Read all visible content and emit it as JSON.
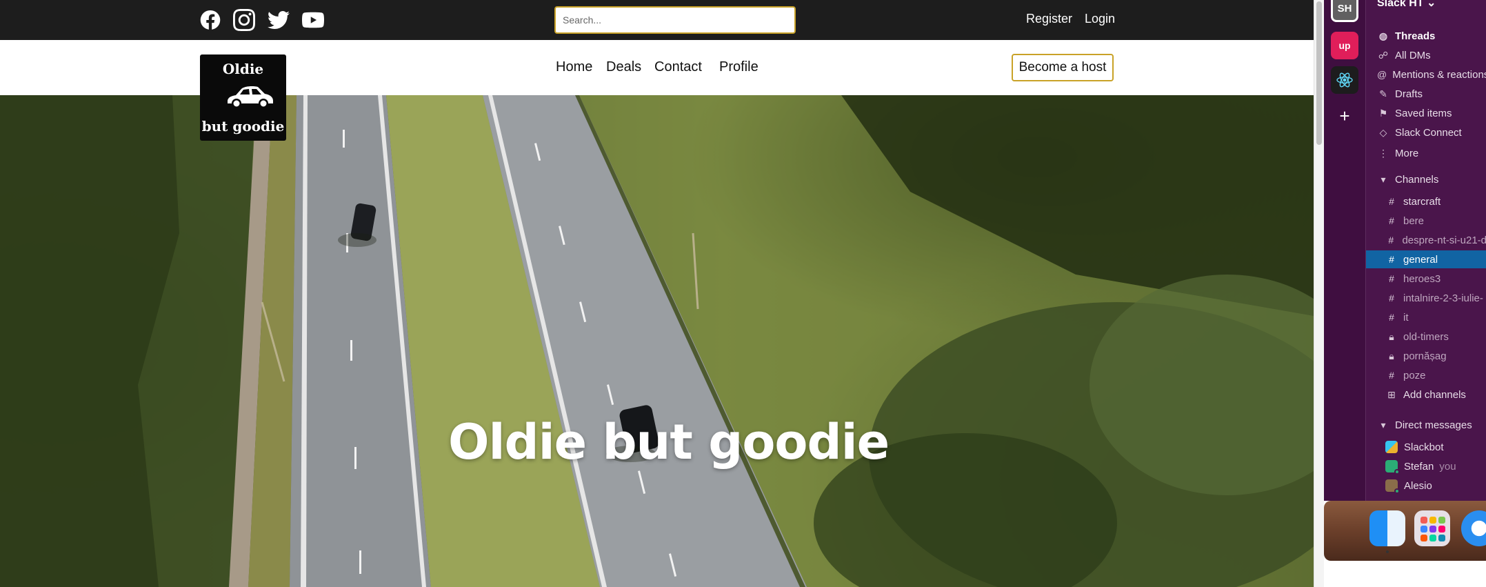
{
  "site": {
    "search": {
      "placeholder": "Search..."
    },
    "top_links": {
      "register": "Register",
      "login": "Login"
    },
    "logo": {
      "line1": "Oldie",
      "line2": "but goodie"
    },
    "nav": [
      "Home",
      "Deals",
      "Contact",
      "Profile"
    ],
    "host_button": "Become a host",
    "hero_title": "Oldie but goodie",
    "social_icons": [
      "facebook-icon",
      "instagram-icon",
      "twitter-icon",
      "youtube-icon"
    ]
  },
  "slack": {
    "workspace_initials": "SH",
    "workspace_name": "Slack HT",
    "rail": {
      "up_label": "up",
      "add_label": "+"
    },
    "nav": [
      {
        "label": "Threads",
        "icon": "threads-icon"
      },
      {
        "label": "All DMs",
        "icon": "dms-icon"
      },
      {
        "label": "Mentions & reactions",
        "icon": "mentions-icon"
      },
      {
        "label": "Drafts",
        "icon": "drafts-icon"
      },
      {
        "label": "Saved items",
        "icon": "bookmark-icon"
      },
      {
        "label": "Slack Connect",
        "icon": "connect-icon"
      },
      {
        "label": "More",
        "icon": "more-icon"
      }
    ],
    "channels_header": "Channels",
    "channels": [
      {
        "name": "starcraft",
        "type": "public"
      },
      {
        "name": "bere",
        "type": "public"
      },
      {
        "name": "despre-nt-si-u21-d",
        "type": "public"
      },
      {
        "name": "general",
        "type": "public"
      },
      {
        "name": "heroes3",
        "type": "public"
      },
      {
        "name": "intalnire-2-3-iulie-",
        "type": "public"
      },
      {
        "name": "it",
        "type": "public"
      },
      {
        "name": "old-timers",
        "type": "private"
      },
      {
        "name": "pornășag",
        "type": "private"
      },
      {
        "name": "poze",
        "type": "public"
      }
    ],
    "add_channels": "Add channels",
    "dm_header": "Direct messages",
    "dms": [
      {
        "name": "Slackbot",
        "suffix": ""
      },
      {
        "name": "Stefan",
        "suffix": "you"
      },
      {
        "name": "Alesio",
        "suffix": ""
      }
    ]
  },
  "colors": {
    "accent_gold": "#c9a227",
    "slack_sidebar": "#4a154b",
    "slack_active": "#1164a3",
    "topbar": "#1d1d1d"
  }
}
